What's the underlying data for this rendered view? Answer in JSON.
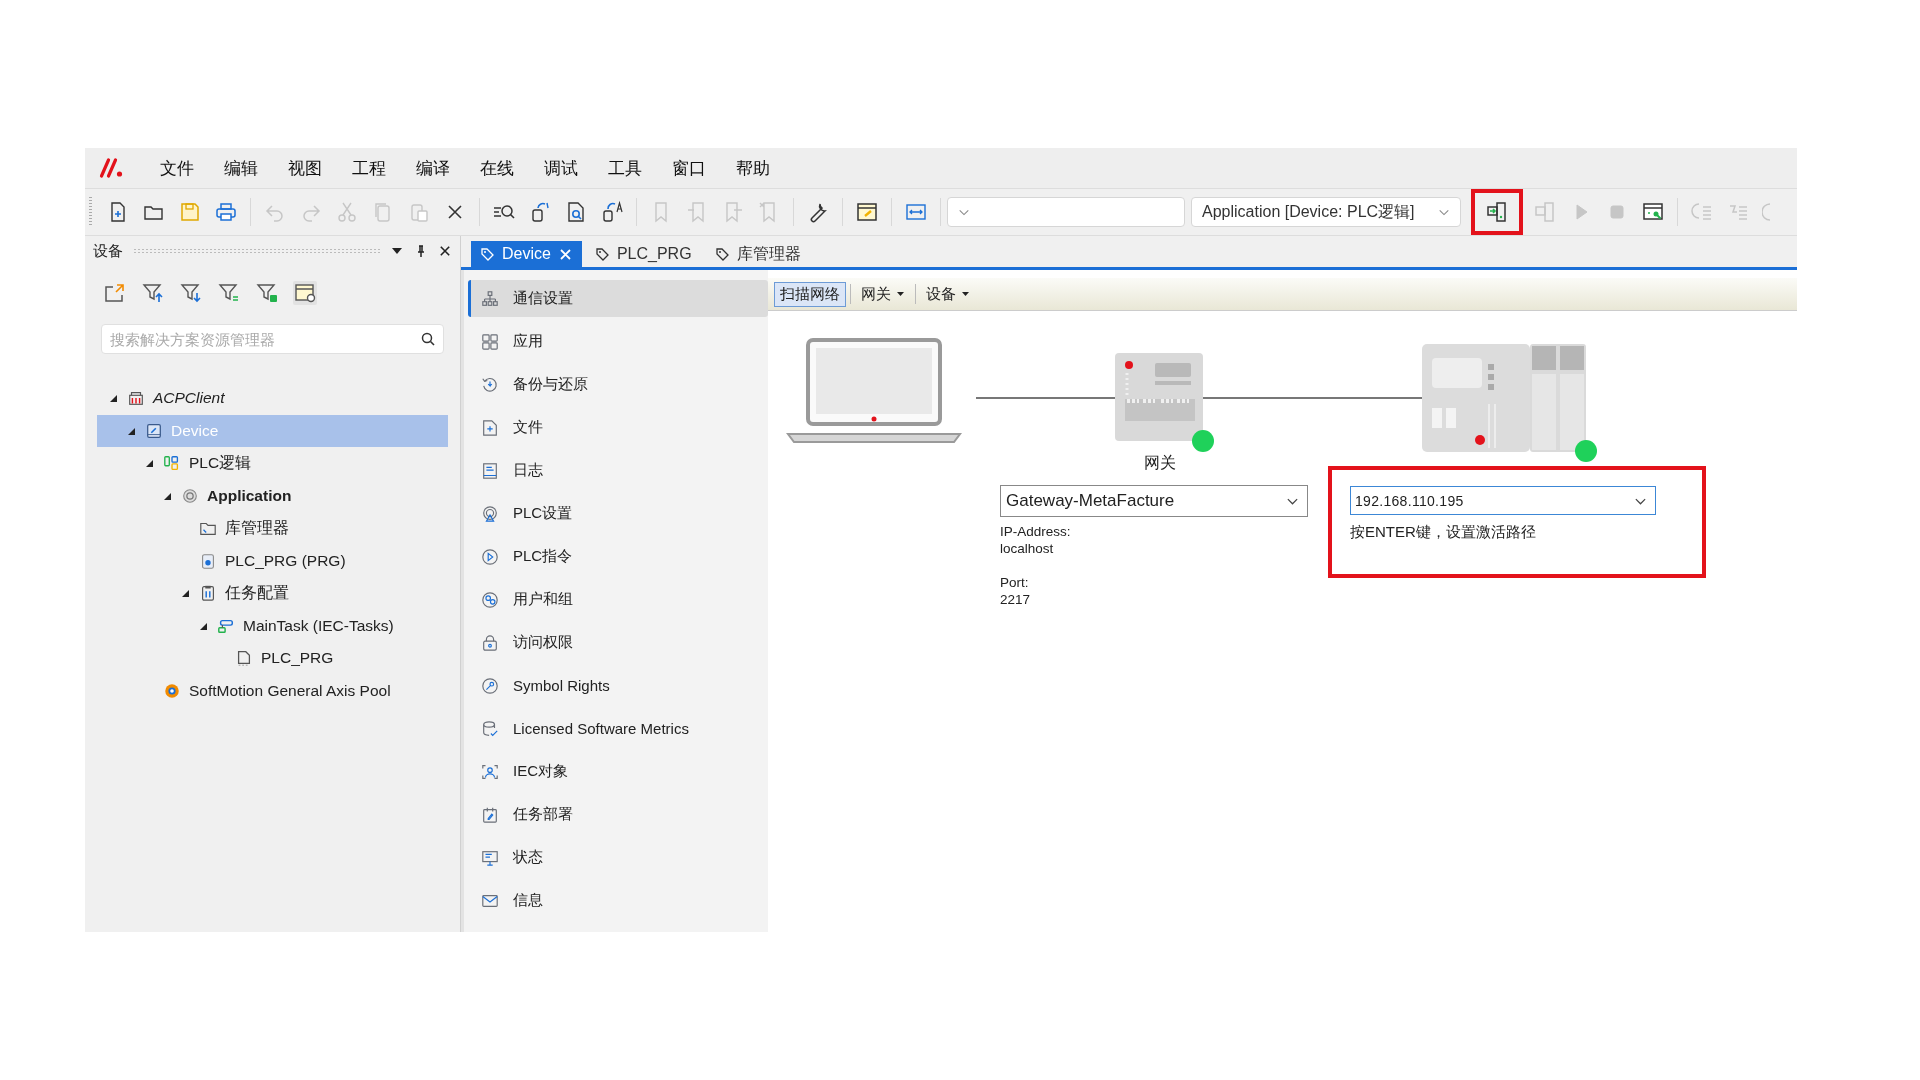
{
  "menu_bar": {
    "items": [
      "文件",
      "编辑",
      "视图",
      "工程",
      "编译",
      "在线",
      "调试",
      "工具",
      "窗口",
      "帮助"
    ]
  },
  "toolbar": {
    "groups_left": [
      [
        {
          "disabled": false
        },
        {
          "disabled": false
        },
        {
          "disabled": false
        },
        {
          "disabled": false
        }
      ],
      [
        {
          "disabled": true
        },
        {
          "disabled": true
        },
        {
          "disabled": true
        },
        {
          "disabled": true
        },
        {
          "disabled": true
        },
        {
          "disabled": false
        }
      ],
      [
        {
          "disabled": false
        },
        {
          "disabled": false
        },
        {
          "disabled": false
        },
        {
          "disabled": false
        }
      ],
      [
        {
          "disabled": true
        },
        {
          "disabled": true
        },
        {
          "disabled": true
        },
        {
          "disabled": true
        }
      ],
      [
        {
          "disabled": false
        }
      ],
      [
        {
          "disabled": false
        }
      ],
      [
        {
          "disabled": false
        }
      ]
    ],
    "target_combo": {
      "value": "Application [Device: PLC逻辑]"
    },
    "buttons_right": [
      {
        "disabled": false,
        "highlighted": true
      },
      {
        "disabled": true,
        "highlighted": false
      },
      {
        "disabled": true,
        "highlighted": false
      },
      {
        "disabled": true,
        "highlighted": false
      },
      {
        "disabled": false,
        "highlighted": false
      },
      {
        "disabled": true,
        "highlighted": false
      },
      {
        "disabled": true,
        "highlighted": false
      },
      {
        "disabled": true,
        "highlighted": false
      }
    ]
  },
  "devices_panel": {
    "title": "设备",
    "search": {
      "placeholder": "搜索解决方案资源管理器"
    },
    "tree": [
      {
        "kind": "project",
        "label": "ACPClient",
        "expanded": true,
        "selected": false,
        "children": [
          {
            "kind": "device",
            "label": "Device",
            "expanded": true,
            "selected": true,
            "children": [
              {
                "kind": "plc",
                "label": "PLC逻辑",
                "expanded": true,
                "selected": false,
                "children": [
                  {
                    "kind": "application",
                    "label": "Application",
                    "expanded": true,
                    "selected": false,
                    "children": [
                      {
                        "kind": "library",
                        "label": "库管理器",
                        "selected": false
                      },
                      {
                        "kind": "pou",
                        "label": "PLC_PRG (PRG)",
                        "selected": false
                      },
                      {
                        "kind": "taskconfig",
                        "label": "任务配置",
                        "expanded": true,
                        "selected": false,
                        "children": [
                          {
                            "kind": "task",
                            "label": "MainTask (IEC-Tasks)",
                            "expanded": true,
                            "selected": false,
                            "children": [
                              {
                                "kind": "taskpou",
                                "label": "PLC_PRG",
                                "selected": false
                              }
                            ]
                          }
                        ]
                      }
                    ]
                  }
                ]
              },
              {
                "kind": "axispool",
                "label": "SoftMotion General Axis Pool",
                "selected": false
              }
            ]
          }
        ]
      }
    ]
  },
  "editor": {
    "tabs": [
      {
        "label": "Device",
        "selected": true
      },
      {
        "label": "PLC_PRG",
        "selected": false
      },
      {
        "label": "库管理器",
        "selected": false
      }
    ],
    "nav": [
      {
        "label": "通信设置",
        "selected": true
      },
      {
        "label": "应用",
        "selected": false
      },
      {
        "label": "备份与还原",
        "selected": false
      },
      {
        "label": "文件",
        "selected": false
      },
      {
        "label": "日志",
        "selected": false
      },
      {
        "label": "PLC设置",
        "selected": false
      },
      {
        "label": "PLC指令",
        "selected": false
      },
      {
        "label": "用户和组",
        "selected": false
      },
      {
        "label": "访问权限",
        "selected": false
      },
      {
        "label": "Symbol Rights",
        "selected": false
      },
      {
        "label": "Licensed Software Metrics",
        "selected": false
      },
      {
        "label": "IEC对象",
        "selected": false
      },
      {
        "label": "任务部署",
        "selected": false
      },
      {
        "label": "状态",
        "selected": false
      },
      {
        "label": "信息",
        "selected": false
      }
    ],
    "scan_toolbar": [
      {
        "label": "扫描网络",
        "selected": true,
        "dropdown": false
      },
      {
        "label": "网关",
        "selected": false,
        "dropdown": true
      },
      {
        "label": "设备",
        "selected": false,
        "dropdown": true
      }
    ],
    "gateway": {
      "label": "网关",
      "value": "Gateway-MetaFacture",
      "online": true,
      "info": [
        [
          "IP-Address:",
          "localhost"
        ],
        [
          "Port:",
          "2217"
        ]
      ]
    },
    "device": {
      "value": "192.168.110.195",
      "hint": "按ENTER键，设置激活路径",
      "online": true,
      "highlighted": true
    }
  }
}
